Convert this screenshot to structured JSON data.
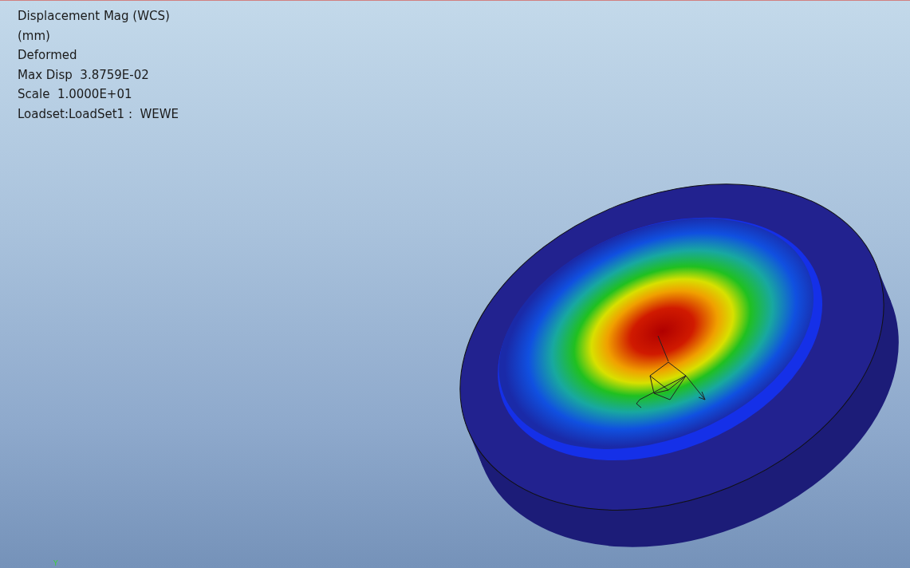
{
  "legend": {
    "lines": [
      "Displacement Mag (WCS)",
      "(mm)",
      "Deformed",
      "Max Disp  3.8759E-02",
      "Scale  1.0000E+01",
      "Loadset:LoadSet1 :  WEWE"
    ]
  },
  "axis_label": "Y"
}
